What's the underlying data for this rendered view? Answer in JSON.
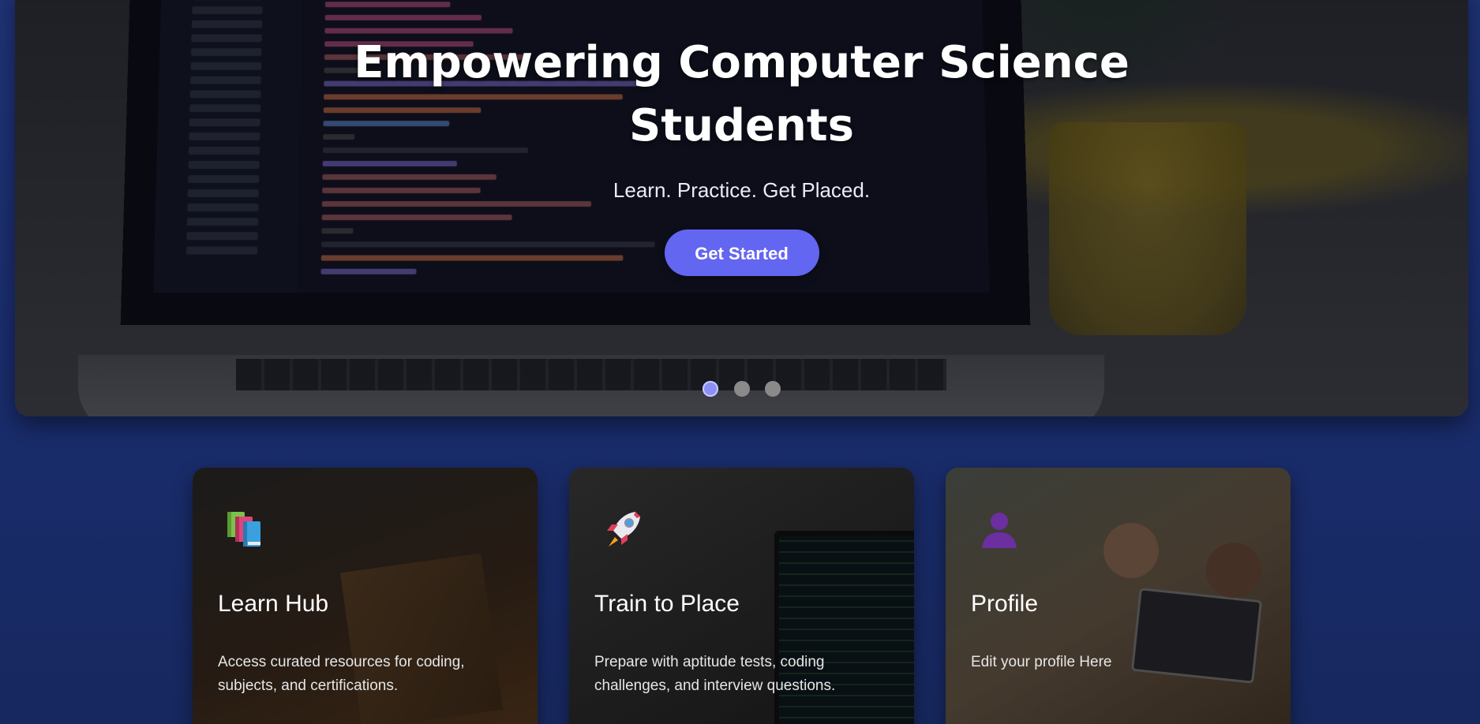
{
  "hero": {
    "title": "Empowering Computer Science Students",
    "subtitle": "Learn. Practice. Get Placed.",
    "button_label": "Get Started",
    "slides": [
      {
        "active": true
      },
      {
        "active": false
      },
      {
        "active": false
      }
    ]
  },
  "cards": [
    {
      "icon": "books-icon",
      "title": "Learn Hub",
      "description": "Access curated resources for coding, subjects, and certifications."
    },
    {
      "icon": "rocket-icon",
      "title": "Train to Place",
      "description": "Prepare with aptitude tests, coding challenges, and interview questions."
    },
    {
      "icon": "user-icon",
      "title": "Profile",
      "description": "Edit your profile Here"
    }
  ],
  "colors": {
    "accent": "#6366f1",
    "background": "#1b2d6b",
    "dot_active": "#8b8ff7",
    "dot_inactive": "#8a8a8a"
  }
}
